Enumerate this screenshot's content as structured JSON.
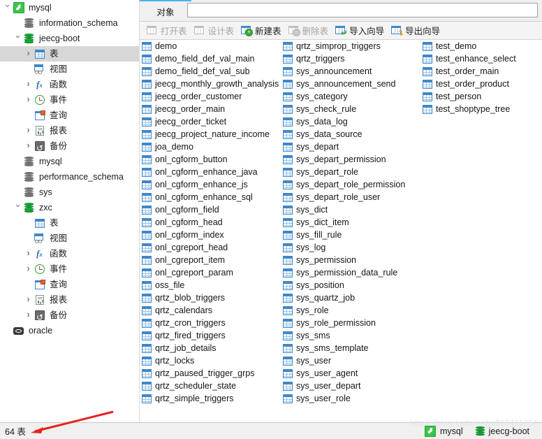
{
  "window": {
    "watermark": "https://blog.csdn.net/u010411264"
  },
  "tabs": {
    "object_tab": "对象",
    "accent_color": "#4ab3e8"
  },
  "search": {
    "value": "",
    "placeholder": ""
  },
  "toolbar": {
    "buttons": [
      {
        "label": "打开表",
        "icon": "open-table-icon",
        "enabled": false
      },
      {
        "label": "设计表",
        "icon": "design-table-icon",
        "enabled": false
      },
      {
        "label": "新建表",
        "icon": "new-table-icon",
        "enabled": true
      },
      {
        "label": "删除表",
        "icon": "delete-table-icon",
        "enabled": false
      },
      {
        "label": "导入向导",
        "icon": "import-wizard-icon",
        "enabled": true
      },
      {
        "label": "导出向导",
        "icon": "export-wizard-icon",
        "enabled": true
      }
    ]
  },
  "tree": {
    "nodes": [
      {
        "label": "mysql",
        "icon": "mysql-connection-icon",
        "indent": 0,
        "twisty": "open",
        "selected": false
      },
      {
        "label": "information_schema",
        "icon": "database-grey-icon",
        "indent": 1,
        "twisty": "none",
        "selected": false
      },
      {
        "label": "jeecg-boot",
        "icon": "database-green-icon",
        "indent": 1,
        "twisty": "open",
        "selected": false
      },
      {
        "label": "表",
        "icon": "table-icon",
        "indent": 2,
        "twisty": "closed",
        "selected": true
      },
      {
        "label": "视图",
        "icon": "view-icon",
        "indent": 2,
        "twisty": "none",
        "selected": false
      },
      {
        "label": "函数",
        "icon": "function-icon",
        "indent": 2,
        "twisty": "closed",
        "selected": false
      },
      {
        "label": "事件",
        "icon": "event-icon",
        "indent": 2,
        "twisty": "closed",
        "selected": false
      },
      {
        "label": "查询",
        "icon": "query-icon",
        "indent": 2,
        "twisty": "none",
        "selected": false
      },
      {
        "label": "报表",
        "icon": "report-icon",
        "indent": 2,
        "twisty": "closed",
        "selected": false
      },
      {
        "label": "备份",
        "icon": "backup-icon",
        "indent": 2,
        "twisty": "closed",
        "selected": false
      },
      {
        "label": "mysql",
        "icon": "database-grey-icon",
        "indent": 1,
        "twisty": "none",
        "selected": false
      },
      {
        "label": "performance_schema",
        "icon": "database-grey-icon",
        "indent": 1,
        "twisty": "none",
        "selected": false
      },
      {
        "label": "sys",
        "icon": "database-grey-icon",
        "indent": 1,
        "twisty": "none",
        "selected": false
      },
      {
        "label": "zxc",
        "icon": "database-green-icon",
        "indent": 1,
        "twisty": "open",
        "selected": false
      },
      {
        "label": "表",
        "icon": "table-icon",
        "indent": 2,
        "twisty": "none",
        "selected": false
      },
      {
        "label": "视图",
        "icon": "view-icon",
        "indent": 2,
        "twisty": "none",
        "selected": false
      },
      {
        "label": "函数",
        "icon": "function-icon",
        "indent": 2,
        "twisty": "closed",
        "selected": false
      },
      {
        "label": "事件",
        "icon": "event-icon",
        "indent": 2,
        "twisty": "closed",
        "selected": false
      },
      {
        "label": "查询",
        "icon": "query-icon",
        "indent": 2,
        "twisty": "none",
        "selected": false
      },
      {
        "label": "报表",
        "icon": "report-icon",
        "indent": 2,
        "twisty": "closed",
        "selected": false
      },
      {
        "label": "备份",
        "icon": "backup-icon",
        "indent": 2,
        "twisty": "closed",
        "selected": false
      },
      {
        "label": "oracle",
        "icon": "oracle-connection-icon",
        "indent": 0,
        "twisty": "none",
        "selected": false
      }
    ]
  },
  "objects": {
    "icon": "table-icon",
    "columns": [
      [
        "demo",
        "demo_field_def_val_main",
        "demo_field_def_val_sub",
        "jeecg_monthly_growth_analysis",
        "jeecg_order_customer",
        "jeecg_order_main",
        "jeecg_order_ticket",
        "jeecg_project_nature_income",
        "joa_demo",
        "onl_cgform_button",
        "onl_cgform_enhance_java",
        "onl_cgform_enhance_js",
        "onl_cgform_enhance_sql",
        "onl_cgform_field",
        "onl_cgform_head",
        "onl_cgform_index",
        "onl_cgreport_head",
        "onl_cgreport_item",
        "onl_cgreport_param",
        "oss_file",
        "qrtz_blob_triggers",
        "qrtz_calendars",
        "qrtz_cron_triggers",
        "qrtz_fired_triggers",
        "qrtz_job_details",
        "qrtz_locks",
        "qrtz_paused_trigger_grps",
        "qrtz_scheduler_state",
        "qrtz_simple_triggers"
      ],
      [
        "qrtz_simprop_triggers",
        "qrtz_triggers",
        "sys_announcement",
        "sys_announcement_send",
        "sys_category",
        "sys_check_rule",
        "sys_data_log",
        "sys_data_source",
        "sys_depart",
        "sys_depart_permission",
        "sys_depart_role",
        "sys_depart_role_permission",
        "sys_depart_role_user",
        "sys_dict",
        "sys_dict_item",
        "sys_fill_rule",
        "sys_log",
        "sys_permission",
        "sys_permission_data_rule",
        "sys_position",
        "sys_quartz_job",
        "sys_role",
        "sys_role_permission",
        "sys_sms",
        "sys_sms_template",
        "sys_user",
        "sys_user_agent",
        "sys_user_depart",
        "sys_user_role"
      ],
      [
        "test_demo",
        "test_enhance_select",
        "test_order_main",
        "test_order_product",
        "test_person",
        "test_shoptype_tree"
      ]
    ]
  },
  "status": {
    "count": "64 表",
    "connection": "mysql",
    "database": "jeecg-boot"
  }
}
